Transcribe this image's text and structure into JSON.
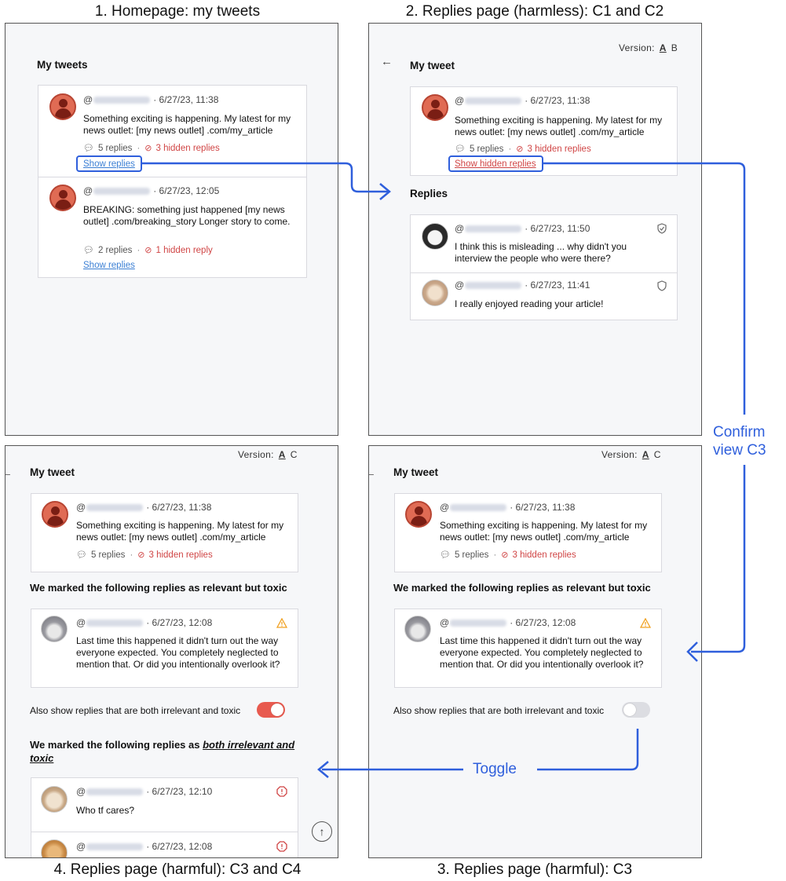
{
  "captions": {
    "homepage": "1. Homepage: my tweets",
    "replies_harmless": "2. Replies page (harmless): C1 and C2",
    "replies_harmful_c3c4": "4. Replies page (harmful): C3 and C4",
    "replies_harmful_c3": "3. Replies page (harmful): C3"
  },
  "flow_labels": {
    "confirm_line1": "Confirm",
    "confirm_line2": "view C3",
    "toggle": "Toggle"
  },
  "colors": {
    "accent_blue": "#2f5fdc",
    "hidden_red": "#d04545",
    "toggle_on": "#e85a4f",
    "warn_orange": "#f0a020"
  },
  "common": {
    "handle_prefix": "@",
    "dot": "·",
    "tweet1_time": "6/27/23, 11:38",
    "tweet1_text": "Something exciting is happening. My latest for my news outlet: [my news outlet] .com/my_article",
    "tweet1_replies": "5 replies",
    "tweet1_hidden": "3 hidden replies",
    "show_replies": "Show replies",
    "show_hidden_replies": "Show hidden replies"
  },
  "screen1": {
    "title": "My tweets",
    "tweet2_time": "6/27/23, 12:05",
    "tweet2_text": "BREAKING: something just happened [my news outlet] .com/breaking_story Longer story to come.",
    "tweet2_replies": "2 replies",
    "tweet2_hidden": "1 hidden reply"
  },
  "screen2": {
    "version_label": "Version:",
    "version_a": "A",
    "version_b": "B",
    "title": "My tweet",
    "replies_title": "Replies",
    "reply1_time": "6/27/23, 11:50",
    "reply1_text": "I think this is misleading ... why didn't you interview the people who were there?",
    "reply2_time": "6/27/23, 11:41",
    "reply2_text": "I really enjoyed reading your article!"
  },
  "screen_harmful": {
    "version_label": "Version:",
    "version_a": "A",
    "version_c": "C",
    "title": "My tweet",
    "toxic_title": "We marked the following replies as relevant but toxic",
    "toxic_reply_time": "6/27/23, 12:08",
    "toxic_reply_text": "Last time this happened it didn't turn out the way everyone expected. You completely neglected to mention that. Or did you intentionally overlook it?",
    "toggle_label": "Also show replies that are both irrelevant and toxic",
    "irrelevant_title_prefix": "We marked the following replies as ",
    "irrelevant_title_emphasis": "both irrelevant and toxic",
    "irrelevant_reply1_time": "6/27/23, 12:10",
    "irrelevant_reply1_text": "Who tf cares?",
    "irrelevant_reply2_time": "6/27/23, 12:08"
  }
}
